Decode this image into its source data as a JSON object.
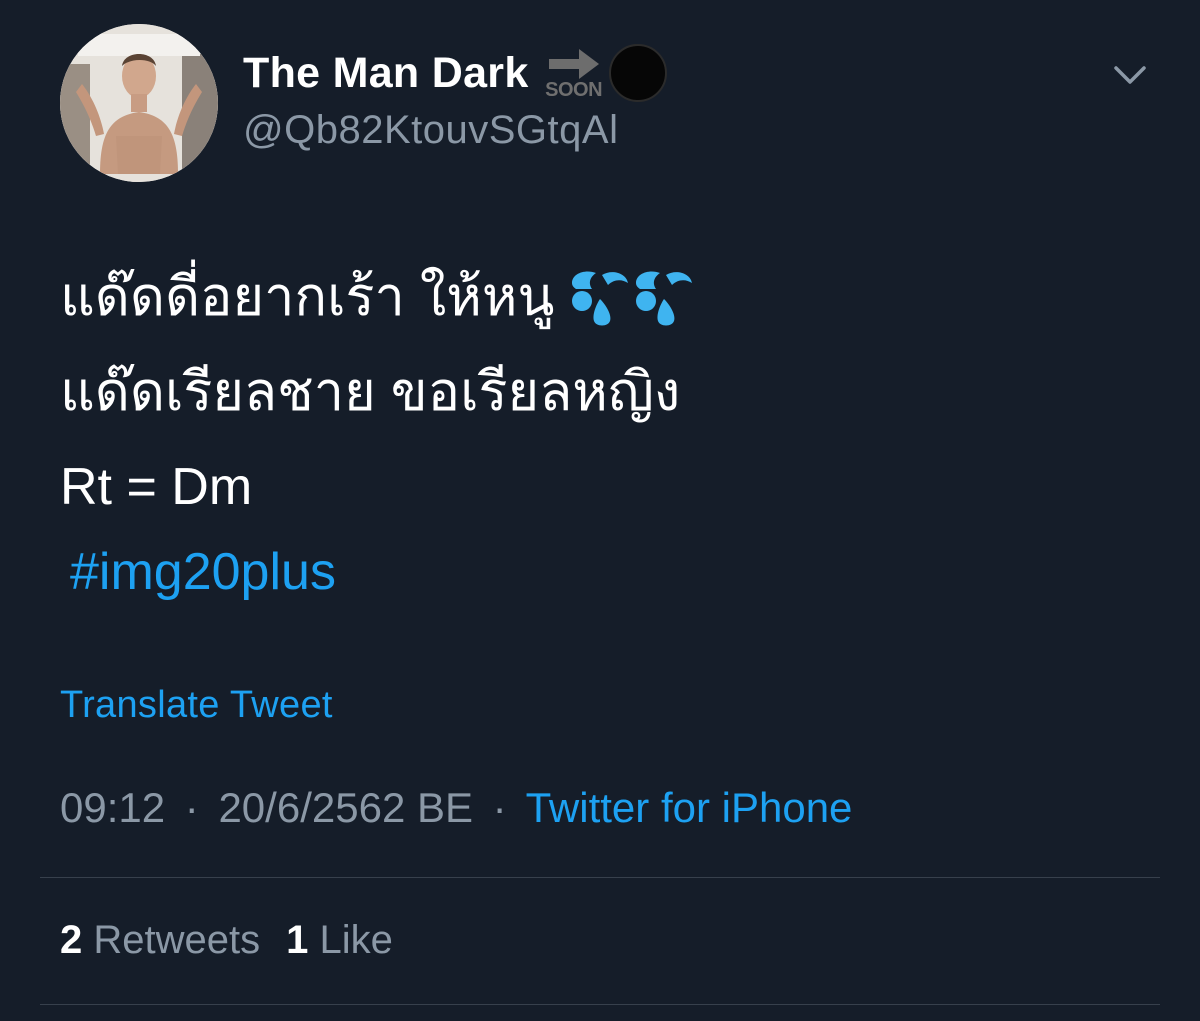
{
  "author": {
    "display_name": "The Man Dark",
    "name_badge_text": "SOON",
    "name_emojis": [
      "soon-arrow-icon",
      "black-circle-icon"
    ],
    "handle": "@Qb82KtouvSGtqAl"
  },
  "tweet": {
    "line1": "แด๊ดดี่อยากเร้า ให้หนู",
    "line1_emoji": "sweat-droplets-icon",
    "line2": "แด๊ดเรียลชาย ขอเรียลหญิง",
    "line3": "Rt = Dm",
    "hashtag": "#img20plus"
  },
  "translate_label": "Translate Tweet",
  "meta": {
    "time": "09:12",
    "date": "20/6/2562 BE",
    "separator": "·",
    "client": "Twitter for iPhone"
  },
  "stats": {
    "retweets_count": "2",
    "retweets_label": "Retweets",
    "likes_count": "1",
    "likes_label": "Like"
  },
  "colors": {
    "background": "#151d29",
    "link_blue": "#1da1f2",
    "secondary_text": "#8b98a6",
    "divider": "#37404c"
  }
}
